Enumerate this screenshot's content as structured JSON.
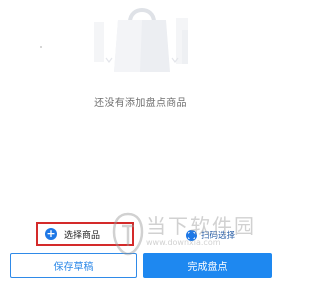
{
  "empty_state": {
    "message": "还没有添加盘点商品",
    "illustration_icon": "shopping-bag-icon"
  },
  "actions": {
    "select_product_label": "选择商品",
    "select_product_icon": "plus-circle-icon",
    "scan_select_label": "扫码选择",
    "scan_select_icon": "scan-icon"
  },
  "bottom_bar": {
    "save_draft_label": "保存草稿",
    "finish_count_label": "完成盘点"
  },
  "watermark": {
    "text": "当下软件园",
    "url": "www.downxia.com",
    "logo_icon": "watermark-logo-icon"
  },
  "colors": {
    "primary": "#1e88f0",
    "highlight_border": "#d42a2a",
    "muted_text": "#6f6f6f"
  }
}
